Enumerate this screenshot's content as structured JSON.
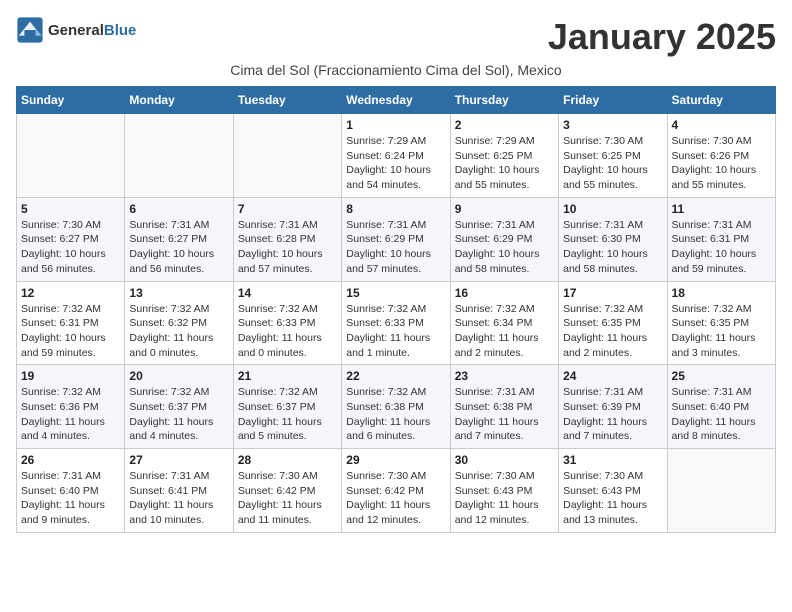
{
  "header": {
    "logo_general": "General",
    "logo_blue": "Blue",
    "month_title": "January 2025",
    "subtitle": "Cima del Sol (Fraccionamiento Cima del Sol), Mexico"
  },
  "calendar": {
    "days_of_week": [
      "Sunday",
      "Monday",
      "Tuesday",
      "Wednesday",
      "Thursday",
      "Friday",
      "Saturday"
    ],
    "weeks": [
      [
        {
          "day": "",
          "info": ""
        },
        {
          "day": "",
          "info": ""
        },
        {
          "day": "",
          "info": ""
        },
        {
          "day": "1",
          "info": "Sunrise: 7:29 AM\nSunset: 6:24 PM\nDaylight: 10 hours and 54 minutes."
        },
        {
          "day": "2",
          "info": "Sunrise: 7:29 AM\nSunset: 6:25 PM\nDaylight: 10 hours and 55 minutes."
        },
        {
          "day": "3",
          "info": "Sunrise: 7:30 AM\nSunset: 6:25 PM\nDaylight: 10 hours and 55 minutes."
        },
        {
          "day": "4",
          "info": "Sunrise: 7:30 AM\nSunset: 6:26 PM\nDaylight: 10 hours and 55 minutes."
        }
      ],
      [
        {
          "day": "5",
          "info": "Sunrise: 7:30 AM\nSunset: 6:27 PM\nDaylight: 10 hours and 56 minutes."
        },
        {
          "day": "6",
          "info": "Sunrise: 7:31 AM\nSunset: 6:27 PM\nDaylight: 10 hours and 56 minutes."
        },
        {
          "day": "7",
          "info": "Sunrise: 7:31 AM\nSunset: 6:28 PM\nDaylight: 10 hours and 57 minutes."
        },
        {
          "day": "8",
          "info": "Sunrise: 7:31 AM\nSunset: 6:29 PM\nDaylight: 10 hours and 57 minutes."
        },
        {
          "day": "9",
          "info": "Sunrise: 7:31 AM\nSunset: 6:29 PM\nDaylight: 10 hours and 58 minutes."
        },
        {
          "day": "10",
          "info": "Sunrise: 7:31 AM\nSunset: 6:30 PM\nDaylight: 10 hours and 58 minutes."
        },
        {
          "day": "11",
          "info": "Sunrise: 7:31 AM\nSunset: 6:31 PM\nDaylight: 10 hours and 59 minutes."
        }
      ],
      [
        {
          "day": "12",
          "info": "Sunrise: 7:32 AM\nSunset: 6:31 PM\nDaylight: 10 hours and 59 minutes."
        },
        {
          "day": "13",
          "info": "Sunrise: 7:32 AM\nSunset: 6:32 PM\nDaylight: 11 hours and 0 minutes."
        },
        {
          "day": "14",
          "info": "Sunrise: 7:32 AM\nSunset: 6:33 PM\nDaylight: 11 hours and 0 minutes."
        },
        {
          "day": "15",
          "info": "Sunrise: 7:32 AM\nSunset: 6:33 PM\nDaylight: 11 hours and 1 minute."
        },
        {
          "day": "16",
          "info": "Sunrise: 7:32 AM\nSunset: 6:34 PM\nDaylight: 11 hours and 2 minutes."
        },
        {
          "day": "17",
          "info": "Sunrise: 7:32 AM\nSunset: 6:35 PM\nDaylight: 11 hours and 2 minutes."
        },
        {
          "day": "18",
          "info": "Sunrise: 7:32 AM\nSunset: 6:35 PM\nDaylight: 11 hours and 3 minutes."
        }
      ],
      [
        {
          "day": "19",
          "info": "Sunrise: 7:32 AM\nSunset: 6:36 PM\nDaylight: 11 hours and 4 minutes."
        },
        {
          "day": "20",
          "info": "Sunrise: 7:32 AM\nSunset: 6:37 PM\nDaylight: 11 hours and 4 minutes."
        },
        {
          "day": "21",
          "info": "Sunrise: 7:32 AM\nSunset: 6:37 PM\nDaylight: 11 hours and 5 minutes."
        },
        {
          "day": "22",
          "info": "Sunrise: 7:32 AM\nSunset: 6:38 PM\nDaylight: 11 hours and 6 minutes."
        },
        {
          "day": "23",
          "info": "Sunrise: 7:31 AM\nSunset: 6:38 PM\nDaylight: 11 hours and 7 minutes."
        },
        {
          "day": "24",
          "info": "Sunrise: 7:31 AM\nSunset: 6:39 PM\nDaylight: 11 hours and 7 minutes."
        },
        {
          "day": "25",
          "info": "Sunrise: 7:31 AM\nSunset: 6:40 PM\nDaylight: 11 hours and 8 minutes."
        }
      ],
      [
        {
          "day": "26",
          "info": "Sunrise: 7:31 AM\nSunset: 6:40 PM\nDaylight: 11 hours and 9 minutes."
        },
        {
          "day": "27",
          "info": "Sunrise: 7:31 AM\nSunset: 6:41 PM\nDaylight: 11 hours and 10 minutes."
        },
        {
          "day": "28",
          "info": "Sunrise: 7:30 AM\nSunset: 6:42 PM\nDaylight: 11 hours and 11 minutes."
        },
        {
          "day": "29",
          "info": "Sunrise: 7:30 AM\nSunset: 6:42 PM\nDaylight: 11 hours and 12 minutes."
        },
        {
          "day": "30",
          "info": "Sunrise: 7:30 AM\nSunset: 6:43 PM\nDaylight: 11 hours and 12 minutes."
        },
        {
          "day": "31",
          "info": "Sunrise: 7:30 AM\nSunset: 6:43 PM\nDaylight: 11 hours and 13 minutes."
        },
        {
          "day": "",
          "info": ""
        }
      ]
    ]
  }
}
